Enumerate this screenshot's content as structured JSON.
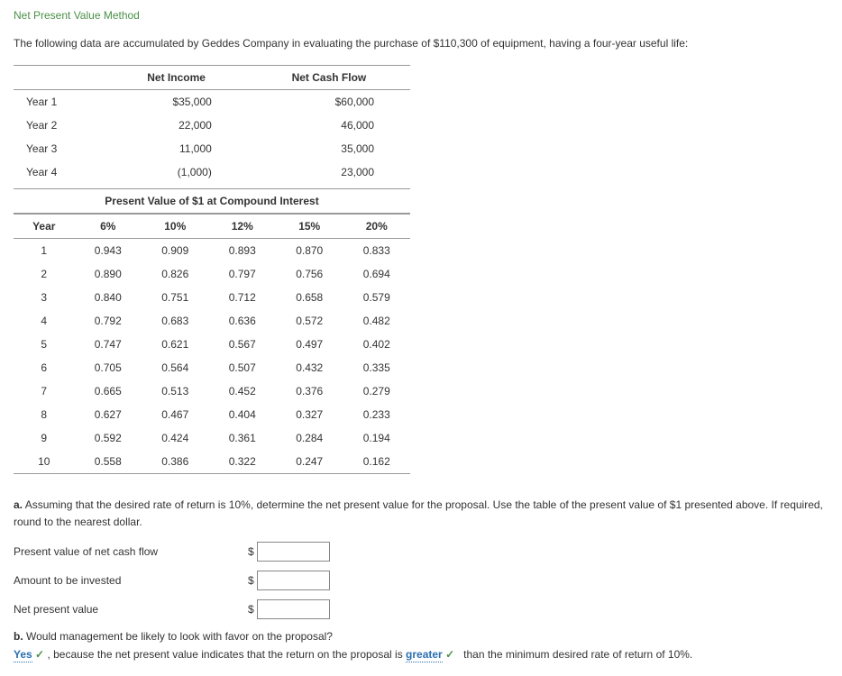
{
  "title": "Net Present Value Method",
  "intro": "The following data are accumulated by Geddes Company in evaluating the purchase of $110,300 of equipment, having a four-year useful life:",
  "table1": {
    "headers": [
      "",
      "Net Income",
      "Net Cash Flow"
    ],
    "rows": [
      {
        "year": "Year 1",
        "income": "$35,000",
        "cashflow": "$60,000"
      },
      {
        "year": "Year 2",
        "income": "22,000",
        "cashflow": "46,000"
      },
      {
        "year": "Year 3",
        "income": "11,000",
        "cashflow": "35,000"
      },
      {
        "year": "Year 4",
        "income": "(1,000)",
        "cashflow": "23,000"
      }
    ]
  },
  "pv_header": "Present Value of $1 at Compound Interest",
  "pv_table": {
    "headers": [
      "Year",
      "6%",
      "10%",
      "12%",
      "15%",
      "20%"
    ],
    "rows": [
      [
        "1",
        "0.943",
        "0.909",
        "0.893",
        "0.870",
        "0.833"
      ],
      [
        "2",
        "0.890",
        "0.826",
        "0.797",
        "0.756",
        "0.694"
      ],
      [
        "3",
        "0.840",
        "0.751",
        "0.712",
        "0.658",
        "0.579"
      ],
      [
        "4",
        "0.792",
        "0.683",
        "0.636",
        "0.572",
        "0.482"
      ],
      [
        "5",
        "0.747",
        "0.621",
        "0.567",
        "0.497",
        "0.402"
      ],
      [
        "6",
        "0.705",
        "0.564",
        "0.507",
        "0.432",
        "0.335"
      ],
      [
        "7",
        "0.665",
        "0.513",
        "0.452",
        "0.376",
        "0.279"
      ],
      [
        "8",
        "0.627",
        "0.467",
        "0.404",
        "0.327",
        "0.233"
      ],
      [
        "9",
        "0.592",
        "0.424",
        "0.361",
        "0.284",
        "0.194"
      ],
      [
        "10",
        "0.558",
        "0.386",
        "0.322",
        "0.247",
        "0.162"
      ]
    ]
  },
  "qa": {
    "a_label": "a.",
    "a_text": "  Assuming that the desired rate of return is 10%, determine the net present value for the proposal. Use the table of the present value of $1 presented above. If required, round to the nearest dollar.",
    "inputs": [
      "Present value of net cash flow",
      "Amount to be invested",
      "Net present value"
    ],
    "dollar": "$",
    "b_label": "b.",
    "b_text": "  Would management be likely to look with favor on the proposal?",
    "answer1": "Yes",
    "answer_mid": " , because the net present value indicates that the return on the proposal is ",
    "answer2": "greater",
    "answer_end": " than the minimum desired rate of return of 10%.",
    "check": "✓"
  }
}
